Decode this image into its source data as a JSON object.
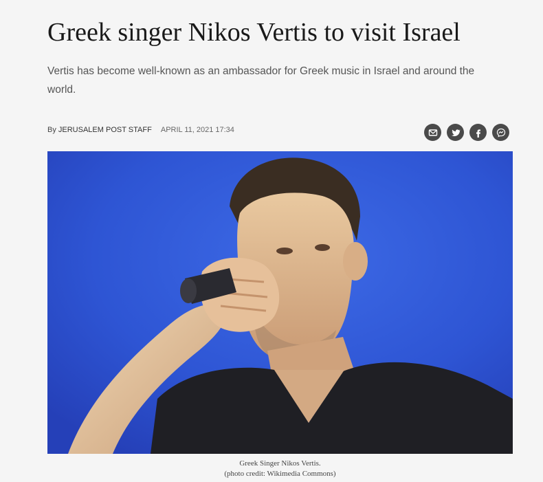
{
  "article": {
    "headline": "Greek singer Nikos Vertis to visit Israel",
    "subheadline": "Vertis has become well-known as an ambassador for Greek music in Israel and around the world.",
    "byline": {
      "prefix": "By",
      "author": "JERUSALEM POST STAFF",
      "date": "APRIL 11, 2021 17:34"
    },
    "share": [
      {
        "name": "email",
        "icon": "email-icon"
      },
      {
        "name": "twitter",
        "icon": "twitter-icon"
      },
      {
        "name": "facebook",
        "icon": "facebook-icon"
      },
      {
        "name": "messenger",
        "icon": "messenger-icon"
      }
    ],
    "photo": {
      "caption_line1": "Greek Singer Nikos Vertis.",
      "caption_line2": "(photo credit: Wikimedia Commons)"
    }
  },
  "colors": {
    "background": "#f5f5f5",
    "share_icon_bg": "#4a4a4a",
    "photo_backdrop": "#2f56d6"
  }
}
